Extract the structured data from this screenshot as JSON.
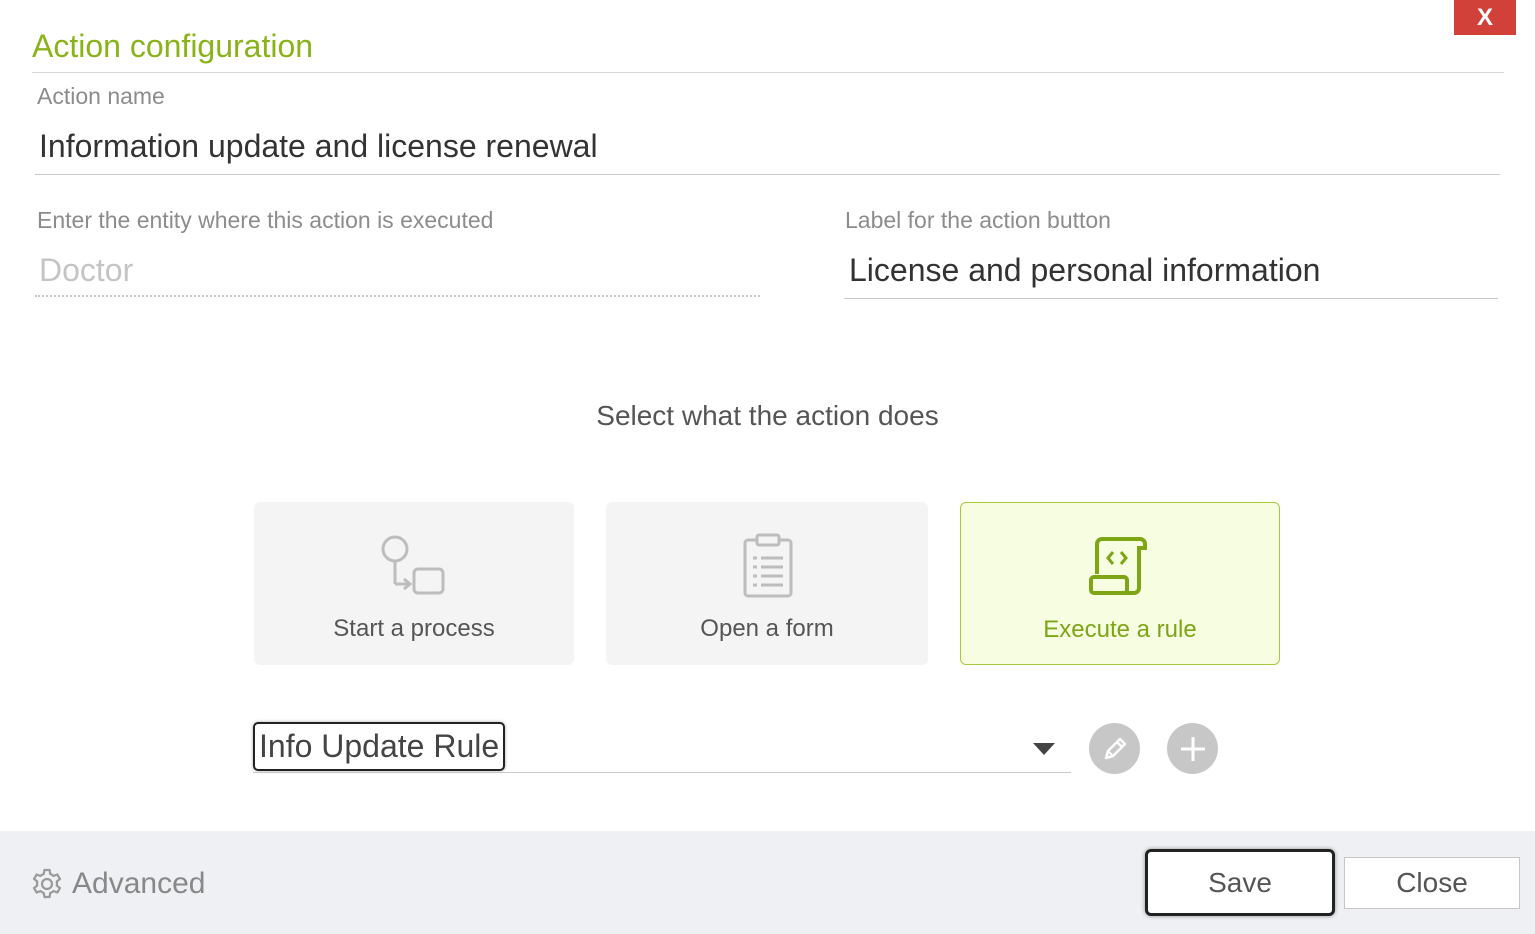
{
  "dialog": {
    "title": "Action configuration",
    "close_label": "X"
  },
  "action_name": {
    "label": "Action name",
    "value": "Information update and license renewal"
  },
  "entity": {
    "label": "Enter the entity where this action is executed",
    "value": "Doctor"
  },
  "button_label": {
    "label": "Label for the action button",
    "value": "License and personal information"
  },
  "action_type": {
    "heading": "Select what the action does",
    "options": [
      {
        "label": "Start a process",
        "icon": "process-icon",
        "selected": false
      },
      {
        "label": "Open a form",
        "icon": "clipboard-icon",
        "selected": false
      },
      {
        "label": "Execute a rule",
        "icon": "rule-script-icon",
        "selected": true
      }
    ]
  },
  "rule_select": {
    "value": "Info Update Rule"
  },
  "footer": {
    "advanced_label": "Advanced",
    "save_label": "Save",
    "close_label": "Close"
  },
  "colors": {
    "accent": "#8ab31b",
    "selected_bg": "#f6fde0",
    "close_red": "#d2403a",
    "footer_bg": "#eef0f4"
  }
}
